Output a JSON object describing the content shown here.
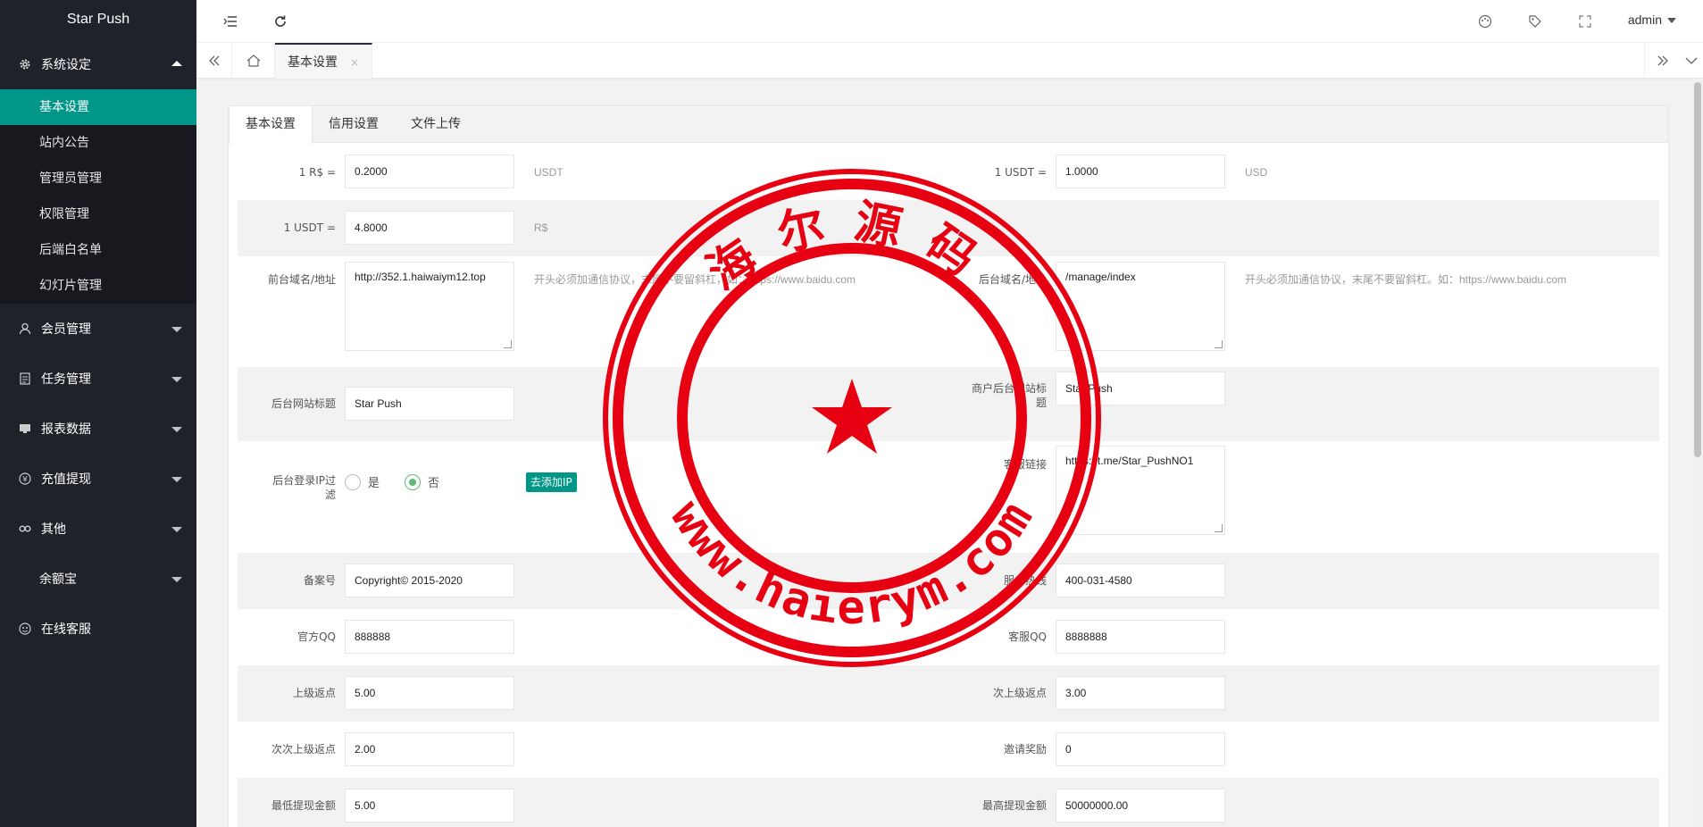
{
  "app": {
    "title": "Star Push"
  },
  "sidebar": {
    "group1": {
      "label": "系统设定",
      "icon": "gear-icon"
    },
    "sub": [
      {
        "label": "基本设置",
        "active": true
      },
      {
        "label": "站内公告"
      },
      {
        "label": "管理员管理"
      },
      {
        "label": "权限管理"
      },
      {
        "label": "后端白名单"
      },
      {
        "label": "幻灯片管理"
      }
    ],
    "members": {
      "label": "会员管理"
    },
    "tasks": {
      "label": "任务管理"
    },
    "reports": {
      "label": "报表数据"
    },
    "recharge": {
      "label": "充值提现"
    },
    "other": {
      "label": "其他"
    },
    "yuebao": {
      "label": "余额宝"
    },
    "service": {
      "label": "在线客服"
    }
  },
  "header": {
    "user": "admin"
  },
  "tabs": {
    "current": "基本设置",
    "close": "×"
  },
  "panel": {
    "tabs": [
      "基本设置",
      "信用设置",
      "文件上传"
    ],
    "rate1": {
      "label": "1 R$ =",
      "value": "0.2000",
      "unit": "USDT"
    },
    "rate2": {
      "label": "1 USDT =",
      "value": "1.0000",
      "unit": "USD"
    },
    "rate3": {
      "label": "1 USDT =",
      "value": "4.8000",
      "unit": "R$"
    },
    "front_domain": {
      "label": "前台域名/地址",
      "value": "http://352.1.haiwaiym12.top",
      "hint": "开头必须加通信协议，末尾不要留斜杠，如：https://www.baidu.com"
    },
    "admin_domain": {
      "label": "后台域名/地址",
      "value": "/manage/index",
      "hint": "开头必须加通信协议，末尾不要留斜杠。如：https://www.baidu.com"
    },
    "admin_title": {
      "label": "后台网站标题",
      "value": "Star Push"
    },
    "merchant_title": {
      "label": "商户后台网站标题",
      "value": "Star Push"
    },
    "ip_filter": {
      "label": "后台登录IP过滤",
      "yes": "是",
      "no": "否",
      "button": "去添加IP"
    },
    "service_link": {
      "label": "客服链接",
      "value": "https://t.me/Star_PushNO1"
    },
    "icp": {
      "label": "备案号",
      "value": "Copyright© 2015-2020"
    },
    "hotline": {
      "label": "服务热线",
      "value": "400-031-4580"
    },
    "official_qq": {
      "label": "官方QQ",
      "value": "888888"
    },
    "service_qq": {
      "label": "客服QQ",
      "value": "8888888"
    },
    "rebate1": {
      "label": "上级返点",
      "value": "5.00"
    },
    "rebate2": {
      "label": "次上级返点",
      "value": "3.00"
    },
    "rebate3": {
      "label": "次次上级返点",
      "value": "2.00"
    },
    "invite": {
      "label": "邀请奖励",
      "value": "0"
    },
    "min_withdraw": {
      "label": "最低提现金额",
      "value": "5.00"
    },
    "max_withdraw": {
      "label": "最高提现金额",
      "value": "50000000.00"
    }
  },
  "watermark": {
    "top_text": "海尔源码",
    "bottom_text": "www.haierym.com"
  },
  "colors": {
    "sidebar": "#20222a",
    "active": "#009688",
    "stamp": "#e60012",
    "radio_on": "#5fb878"
  }
}
